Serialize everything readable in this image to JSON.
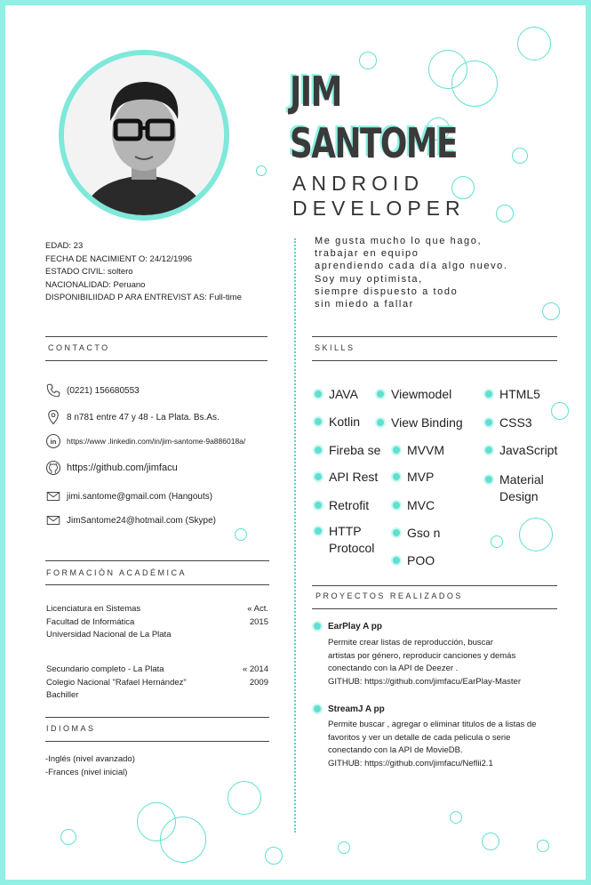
{
  "header": {
    "name_line1": "JIM",
    "name_line2": "SANTOME",
    "title_line1": "ANDROID",
    "title_line2": "DEVELOPER"
  },
  "personal": [
    "EDAD: 23",
    "FECHA DE NACIMIENT O: 24/12/1996",
    "ESTADO CIVIL:  soltero",
    "NACIONALIDAD: Peruano",
    "DISPONIBILIIDAD P ARA ENTREVIST AS: Full-time"
  ],
  "about": [
    "Me  gusta mucho lo que hago,",
    "trabajar en equipo",
    "aprendiendo cada día algo nuevo.",
    "Soy muy optimista,",
    "siempre dispuesto a todo",
    "sin miedo a fallar"
  ],
  "contact": {
    "title": "CONTACTO",
    "phone": "(0221) 156680553",
    "address": "8 n781 entre 47 y 48 - La Plata. Bs.As.",
    "linkedin": "https://www .linkedin.com/in/jim-santome-9a886018a/",
    "github": "https://github.com/jimfacu",
    "email1": "jimi.santome@gmail.com  (Hangouts)",
    "email2": "JimSantome24@hotmail.com  (Skype)"
  },
  "skills": {
    "title": "SKILLS",
    "col1": [
      "JAVA",
      "Kotlin",
      "Fireba se",
      "API Rest",
      "Retrofit",
      "HTTP\nProtocol"
    ],
    "col2": [
      "Viewmodel",
      "View Binding",
      "MVVM",
      "MVP",
      "MVC",
      "Gso n",
      "POO"
    ],
    "col3": [
      "HTML5",
      "CSS3",
      "JavaScript",
      "Material\nDesign"
    ]
  },
  "education": {
    "title": "FORMACIÓN ACADÉMICA",
    "items": [
      {
        "lines": [
          "Licenciatura en Sistemas",
          "Facultad de Informática",
          "Universidad Nacional de La Plata"
        ],
        "date_lines": [
          "« Act.",
          "2015"
        ]
      },
      {
        "lines": [
          "Secundario completo - La Plata",
          "Colegio Nacional \"Rafael Hernández\"",
          "Bachiller"
        ],
        "date_lines": [
          "« 2014",
          "2009"
        ]
      }
    ]
  },
  "languages": {
    "title": "IDIOMAS",
    "items": [
      "-Inglés (nivel avanzado)",
      "-Frances (nivel inicial)"
    ]
  },
  "projects": {
    "title": "PROYECTOS REALIZADOS",
    "items": [
      {
        "name": "EarPlay A pp",
        "desc": [
          "Permite crear listas de reproducción, buscar",
          "artistas por género, reproducir canciones y demás",
          "conectando con la  API de Deezer .",
          "GITHUB: https://github.com/jimfacu/EarPlay-Master"
        ]
      },
      {
        "name": "StreamJ A pp",
        "desc": [
          "Permite buscar , agregar o eliminar titulos de a listas de",
          "favoritos y ver un detalle de cada pelicula o serie",
          "conectando con la  API de MovieDB.",
          "GITHUB: https://github.com/jimfacu/Neflii2.1"
        ]
      }
    ]
  },
  "icons": {
    "phone": "phone-icon",
    "address": "location-pin-icon",
    "linkedin": "linkedin-icon",
    "github": "github-icon",
    "email": "envelope-icon"
  },
  "colors": {
    "accent": "#5fe0d0",
    "border": "#8ff0e3",
    "text": "#222222"
  }
}
